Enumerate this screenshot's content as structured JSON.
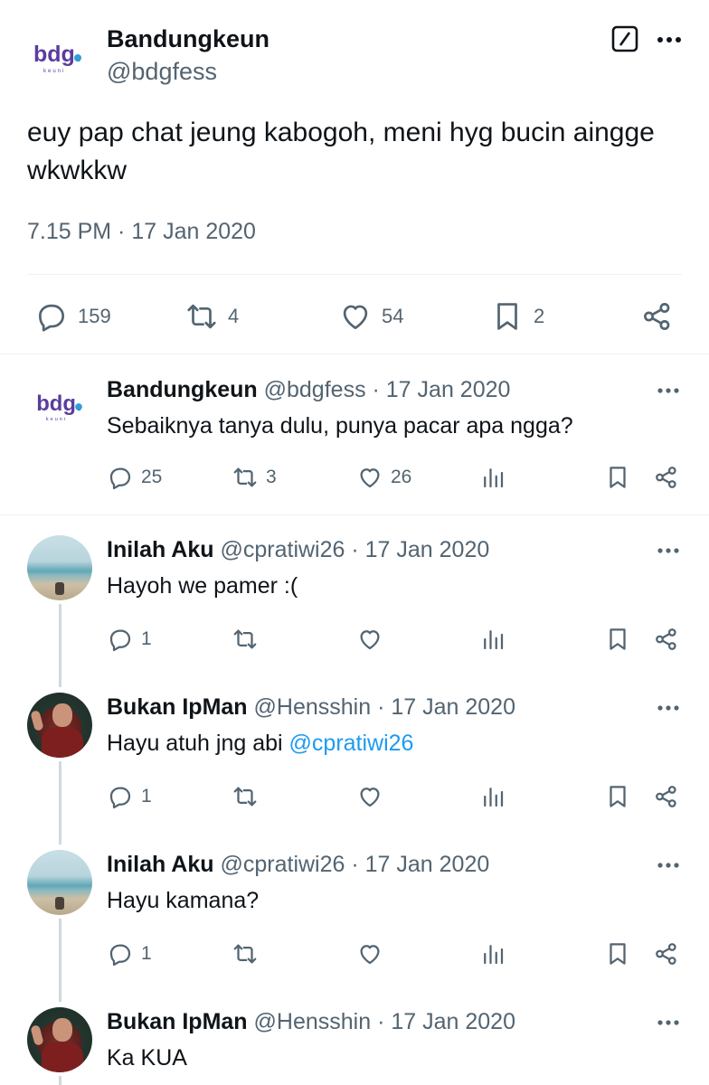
{
  "main_tweet": {
    "avatar_logo": "bdg.",
    "avatar_logo_sub": "keuni",
    "name": "Bandungkeun",
    "handle": "@bdgfess",
    "text": "euy pap chat jeung kabogoh, meni hyg bucin aingge wkwkkw",
    "timestamp": "7.15 PM · 17 Jan 2020",
    "replies": "159",
    "retweets": "4",
    "likes": "54",
    "bookmarks": "2"
  },
  "replies": [
    {
      "avatar": "bdg-logo",
      "name": "Bandungkeun",
      "meta": "@bdgfess · 17 Jan 2020",
      "text": "Sebaiknya tanya dulu, punya pacar apa ngga?",
      "mention": "",
      "replies": "25",
      "retweets": "3",
      "likes": "26"
    },
    {
      "avatar": "beach-photo",
      "name": "Inilah Aku",
      "meta": "@cpratiwi26 · 17 Jan 2020",
      "text": "Hayoh we pamer :(",
      "mention": "",
      "replies": "1",
      "retweets": "",
      "likes": ""
    },
    {
      "avatar": "man-photo",
      "name": "Bukan IpMan",
      "meta": "@Hensshin · 17 Jan 2020",
      "text": "Hayu atuh jng abi ",
      "mention": "@cpratiwi26",
      "replies": "1",
      "retweets": "",
      "likes": ""
    },
    {
      "avatar": "beach-photo",
      "name": "Inilah Aku",
      "meta": "@cpratiwi26 · 17 Jan 2020",
      "text": "Hayu kamana?",
      "mention": "",
      "replies": "1",
      "retweets": "",
      "likes": ""
    },
    {
      "avatar": "man-photo",
      "name": "Bukan IpMan",
      "meta": "@Hensshin · 17 Jan 2020",
      "text": "Ka KUA",
      "mention": "",
      "replies": "",
      "retweets": "",
      "likes": ""
    }
  ],
  "colors": {
    "text": "#0f1419",
    "muted": "#536471",
    "link": "#1d9bf0",
    "divider": "#eff3f4",
    "thread_line": "#cfd9de",
    "logo_purple": "#5b3c9e",
    "logo_blue": "#2f9fd8"
  }
}
